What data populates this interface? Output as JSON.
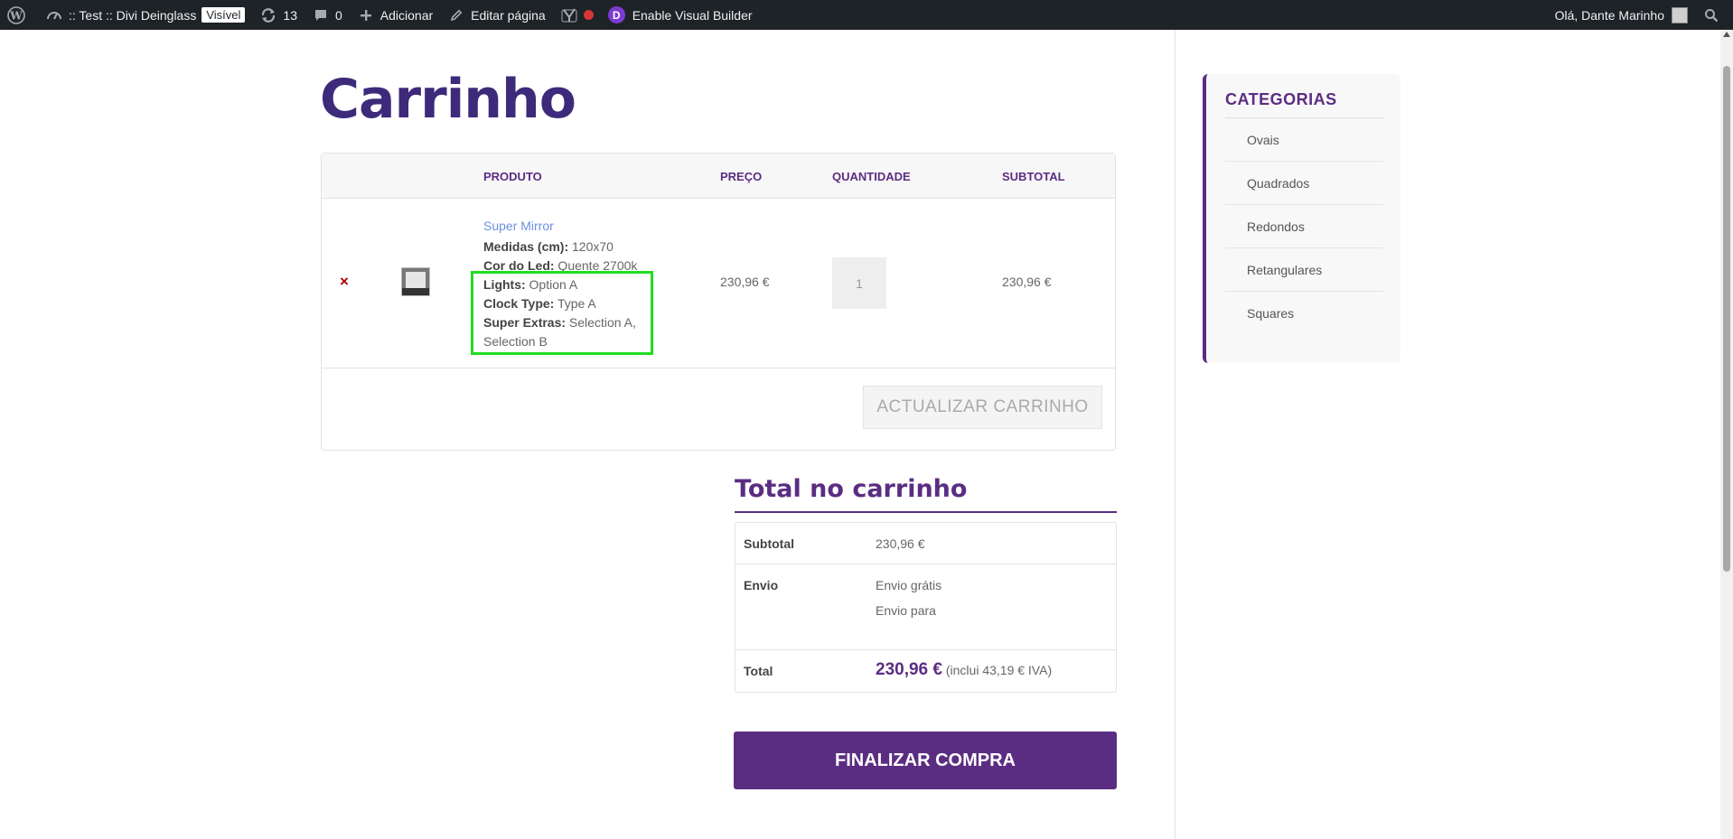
{
  "adminbar": {
    "site_name": ":: Test :: Divi Deinglass",
    "visible_badge": "Visível",
    "updates_count": "13",
    "comments_count": "0",
    "add_label": "Adicionar",
    "edit_label": "Editar página",
    "visual_builder_label": "Enable Visual Builder",
    "greeting": "Olá, Dante Marinho"
  },
  "page": {
    "title": "Carrinho"
  },
  "cart": {
    "headers": {
      "product": "PRODUTO",
      "price": "PREÇO",
      "quantity": "QUANTIDADE",
      "subtotal": "SUBTOTAL"
    },
    "item": {
      "remove_symbol": "×",
      "name": "Super Mirror",
      "meta": [
        {
          "key": "Medidas (cm):",
          "value": " 120x70"
        },
        {
          "key": "Cor do Led:",
          "value": " Quente 2700k"
        },
        {
          "key": "Lights:",
          "value": " Option A"
        },
        {
          "key": "Clock Type:",
          "value": " Type A"
        },
        {
          "key": "Super Extras:",
          "value": " Selection A,"
        },
        {
          "key": "",
          "value": "Selection B"
        }
      ],
      "price": "230,96 €",
      "quantity": "1",
      "subtotal": "230,96 €"
    },
    "update_button": "ACTUALIZAR CARRINHO"
  },
  "totals": {
    "title": "Total no carrinho",
    "subtotal_label": "Subtotal",
    "subtotal_value": "230,96 €",
    "shipping_label": "Envio",
    "shipping_line1": "Envio grátis",
    "shipping_line2": "Envio para",
    "total_label": "Total",
    "total_value": "230,96 €",
    "total_tax_note": "(inclui 43,19 € IVA)",
    "checkout_button": "FINALIZAR COMPRA"
  },
  "sidebar": {
    "title": "CATEGORIAS",
    "categories": [
      "Ovais",
      "Quadrados",
      "Redondos",
      "Retangulares",
      "Squares"
    ]
  },
  "colors": {
    "accent": "#5b2d82",
    "title": "#3d2a7a",
    "highlight": "#22dd22",
    "adminbar": "#1d2327"
  }
}
